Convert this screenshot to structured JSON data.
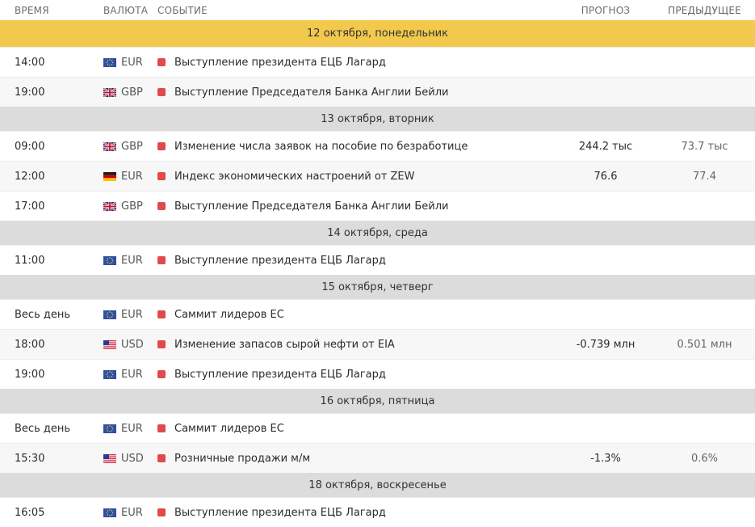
{
  "header": {
    "time": "ВРЕМЯ",
    "currency": "ВАЛЮТА",
    "event": "СОБЫТИЕ",
    "forecast": "ПРОГНОЗ",
    "previous": "ПРЕДЫДУЩЕЕ"
  },
  "colors": {
    "highlight_day": "#f2c94c",
    "day_header": "#dcdcdc",
    "importance_high": "#e04a4a"
  },
  "days": [
    {
      "label": "12 октября, понедельник",
      "active": true,
      "events": [
        {
          "time": "14:00",
          "flag": "eu-flag-icon",
          "currency": "EUR",
          "title": "Выступление президента ЕЦБ Лагард",
          "forecast": "",
          "previous": ""
        },
        {
          "time": "19:00",
          "flag": "uk-flag-icon",
          "currency": "GBP",
          "title": "Выступление Председателя Банка Англии Бейли",
          "forecast": "",
          "previous": ""
        }
      ]
    },
    {
      "label": "13 октября, вторник",
      "active": false,
      "events": [
        {
          "time": "09:00",
          "flag": "uk-flag-icon",
          "currency": "GBP",
          "title": "Изменение числа заявок на пособие по безработице",
          "forecast": "244.2 тыс",
          "previous": "73.7 тыс"
        },
        {
          "time": "12:00",
          "flag": "de-flag-icon",
          "currency": "EUR",
          "title": "Индекс экономических настроений от ZEW",
          "forecast": "76.6",
          "previous": "77.4"
        },
        {
          "time": "17:00",
          "flag": "uk-flag-icon",
          "currency": "GBP",
          "title": "Выступление Председателя Банка Англии Бейли",
          "forecast": "",
          "previous": ""
        }
      ]
    },
    {
      "label": "14 октября, среда",
      "active": false,
      "events": [
        {
          "time": "11:00",
          "flag": "eu-flag-icon",
          "currency": "EUR",
          "title": "Выступление президента ЕЦБ Лагард",
          "forecast": "",
          "previous": ""
        }
      ]
    },
    {
      "label": "15 октября, четверг",
      "active": false,
      "events": [
        {
          "time": "Весь день",
          "flag": "eu-flag-icon",
          "currency": "EUR",
          "title": "Саммит лидеров ЕС",
          "forecast": "",
          "previous": ""
        },
        {
          "time": "18:00",
          "flag": "us-flag-icon",
          "currency": "USD",
          "title": "Изменение запасов сырой нефти от EIA",
          "forecast": "-0.739 млн",
          "previous": "0.501 млн"
        },
        {
          "time": "19:00",
          "flag": "eu-flag-icon",
          "currency": "EUR",
          "title": "Выступление президента ЕЦБ Лагард",
          "forecast": "",
          "previous": ""
        }
      ]
    },
    {
      "label": "16 октября, пятница",
      "active": false,
      "events": [
        {
          "time": "Весь день",
          "flag": "eu-flag-icon",
          "currency": "EUR",
          "title": "Саммит лидеров ЕС",
          "forecast": "",
          "previous": ""
        },
        {
          "time": "15:30",
          "flag": "us-flag-icon",
          "currency": "USD",
          "title": "Розничные продажи м/м",
          "forecast": "-1.3%",
          "previous": "0.6%"
        }
      ]
    },
    {
      "label": "18 октября, воскресенье",
      "active": false,
      "events": [
        {
          "time": "16:05",
          "flag": "eu-flag-icon",
          "currency": "EUR",
          "title": "Выступление президента ЕЦБ Лагард",
          "forecast": "",
          "previous": ""
        }
      ]
    }
  ]
}
